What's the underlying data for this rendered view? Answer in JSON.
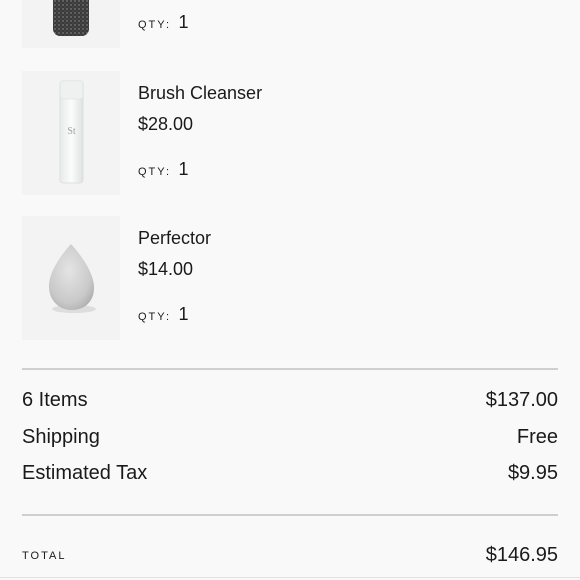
{
  "cart": {
    "items": [
      {
        "name": "",
        "price": "",
        "qty_label": "QTY:",
        "qty": "1",
        "icon": "charcoal-sponge-image"
      },
      {
        "name": "Brush Cleanser",
        "price": "$28.00",
        "qty_label": "QTY:",
        "qty": "1",
        "icon": "cleanser-bottle-image",
        "bottle_mark": "St"
      },
      {
        "name": "Perfector",
        "price": "$14.00",
        "qty_label": "QTY:",
        "qty": "1",
        "icon": "makeup-sponge-image"
      }
    ]
  },
  "summary": {
    "items_label": "6 Items",
    "items_value": "$137.00",
    "shipping_label": "Shipping",
    "shipping_value": "Free",
    "tax_label": "Estimated Tax",
    "tax_value": "$9.95",
    "total_label": "TOTAL",
    "total_value": "$146.95"
  },
  "colors": {
    "background": "#f9f9f9",
    "divider": "#cfcfcf",
    "text": "#1a1a1a"
  }
}
